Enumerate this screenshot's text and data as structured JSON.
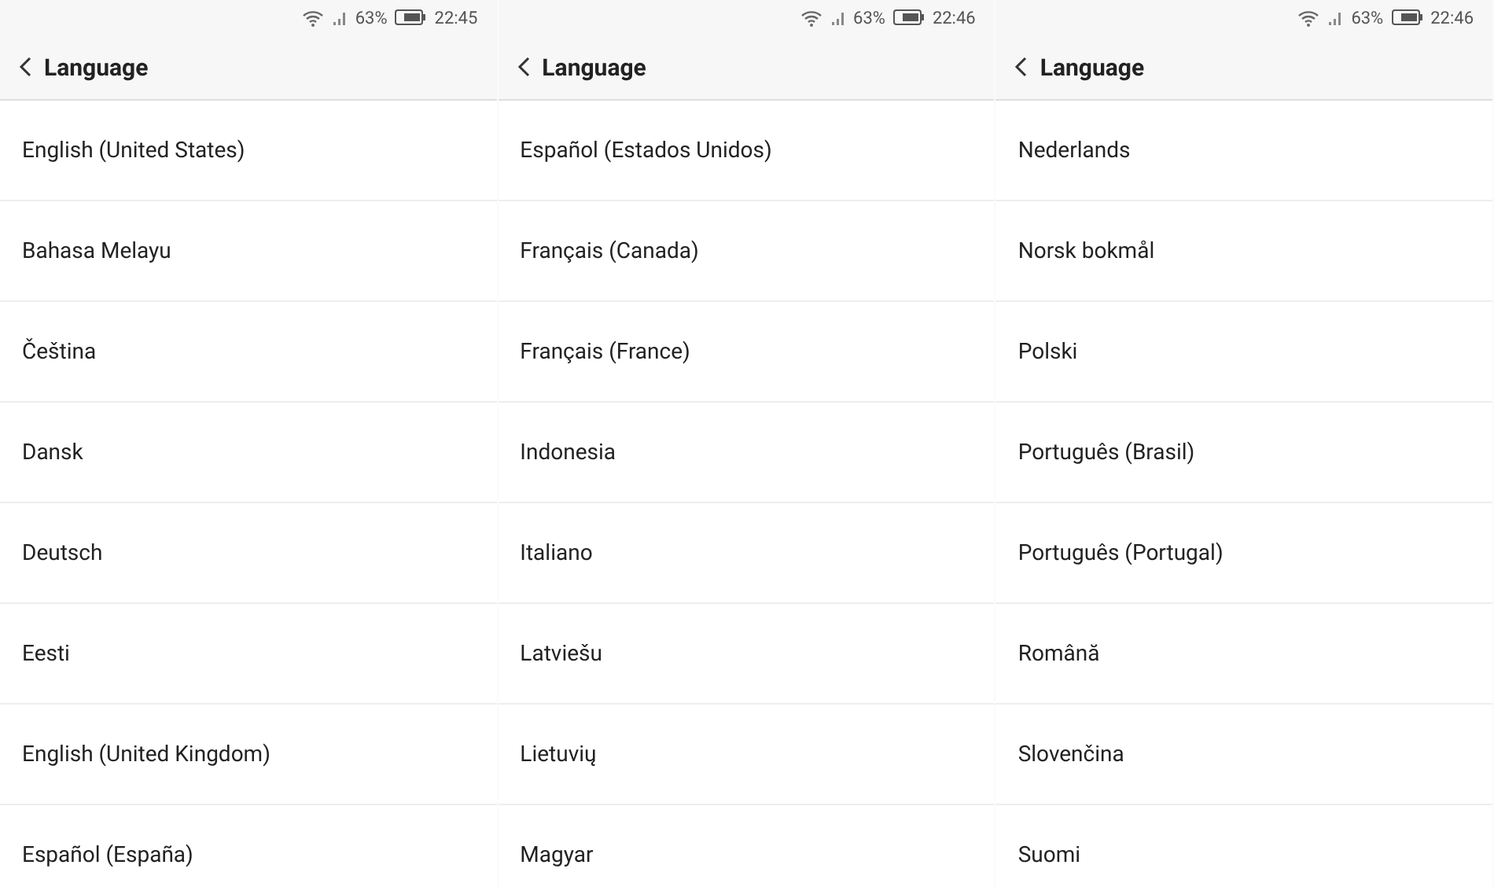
{
  "screens": [
    {
      "status_bar": {
        "battery": "63%",
        "time": "22:45"
      },
      "header": {
        "title": "Language"
      },
      "items": [
        "English (United States)",
        "Bahasa Melayu",
        "Čeština",
        "Dansk",
        "Deutsch",
        "Eesti",
        "English (United Kingdom)",
        "Español (España)"
      ]
    },
    {
      "status_bar": {
        "battery": "63%",
        "time": "22:46"
      },
      "header": {
        "title": "Language"
      },
      "items": [
        "Español (Estados Unidos)",
        "Français (Canada)",
        "Français (France)",
        "Indonesia",
        "Italiano",
        "Latviešu",
        "Lietuvių",
        "Magyar"
      ]
    },
    {
      "status_bar": {
        "battery": "63%",
        "time": "22:46"
      },
      "header": {
        "title": "Language"
      },
      "items": [
        "Nederlands",
        "Norsk bokmål",
        "Polski",
        "Português (Brasil)",
        "Português (Portugal)",
        "Română",
        "Slovenčina",
        "Suomi"
      ]
    }
  ]
}
